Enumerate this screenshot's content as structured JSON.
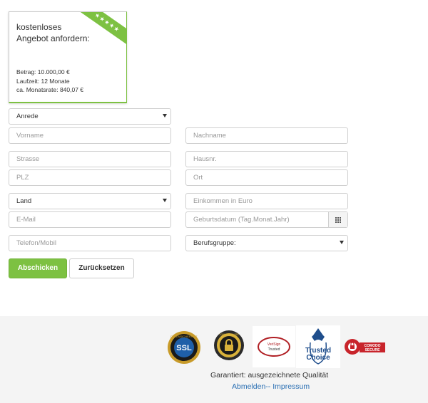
{
  "offer_card": {
    "ribbon_stars": "★★★★★",
    "title": "kostenloses Angebot anfordern:",
    "betrag": "Betrag: 10.000,00 €",
    "laufzeit": "Laufzeit: 12 Monate",
    "monatsrate": "ca. Monatsrate: 840,07 €"
  },
  "form": {
    "anrede": "Anrede",
    "vorname_placeholder": "Vorname",
    "nachname_placeholder": "Nachname",
    "strasse_placeholder": "Strasse",
    "hausnr_placeholder": "Hausnr.",
    "plz_placeholder": "PLZ",
    "ort_placeholder": "Ort",
    "land": "Land",
    "einkommen_placeholder": "Einkommen in Euro",
    "email_placeholder": "E-Mail",
    "geburtsdatum_placeholder": "Geburtsdatum (Tag.Monat.Jahr)",
    "telefon_placeholder": "Telefon/Mobil",
    "berufsgruppe": "Berufsgruppe:",
    "submit_label": "Abschicken",
    "reset_label": "Zurücksetzen"
  },
  "footer": {
    "badges": {
      "ssl": "SSL",
      "ssl_ring": "DATENSICHERHEIT",
      "secure": "100% SECURE",
      "verisign_1": "VeriSign",
      "verisign_2": "Trusted",
      "trusted_1": "Trusted",
      "trusted_2": "Choice",
      "comodo_1": "COMODO",
      "comodo_2": "SECURE"
    },
    "guarantee": "Garantiert: ausgezeichnete Qualität",
    "abmelden": "Abmelden",
    "separator": "--",
    "impressum": "Impressum"
  },
  "colors": {
    "accent": "#7dc142",
    "link": "#2a6fb3"
  }
}
